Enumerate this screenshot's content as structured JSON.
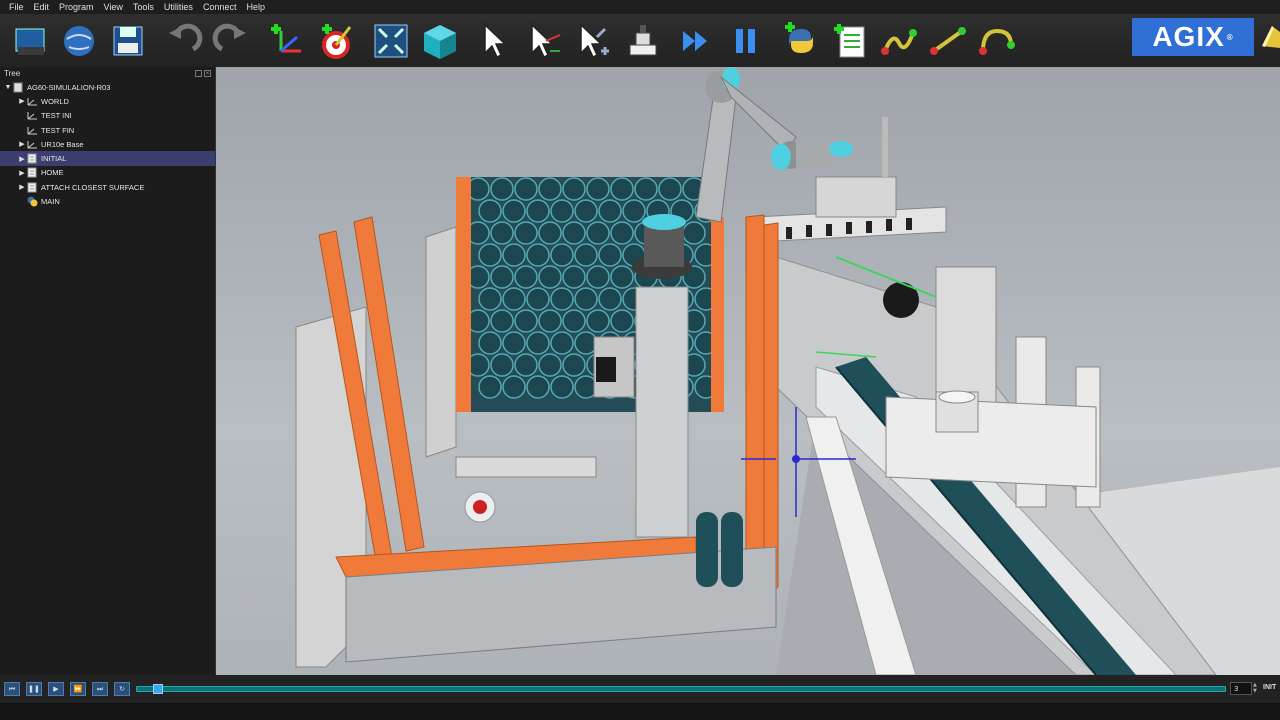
{
  "menu": [
    "File",
    "Edit",
    "Program",
    "View",
    "Tools",
    "Utilities",
    "Connect",
    "Help"
  ],
  "toolbar": {
    "buttons": [
      "open-station-icon",
      "online-library-icon",
      "save-icon",
      "undo-icon",
      "redo-icon",
      "add-reference-frame-icon",
      "add-target-icon",
      "fit-all-icon",
      "view-iso-icon",
      "select-icon",
      "move-reference-icon",
      "move-object-icon",
      "add-tool-icon",
      "fast-simulation-icon",
      "pause-simulation-icon",
      "python-script-icon",
      "add-program-icon",
      "move-joint-icon",
      "move-linear-icon",
      "move-circular-icon"
    ],
    "logo_text": "AGIX",
    "logo_mark": "®"
  },
  "tree": {
    "title": "Tree",
    "items": [
      {
        "label": "AG60-SIMULALION-R03",
        "level": 0,
        "icon": "station-icon",
        "expanded": true,
        "selected": false
      },
      {
        "label": "WORLD",
        "level": 1,
        "icon": "frame-icon",
        "expanded": false,
        "selected": false
      },
      {
        "label": "TEST INI",
        "level": 1,
        "icon": "frame-icon",
        "expanded": null,
        "selected": false
      },
      {
        "label": "TEST FIN",
        "level": 1,
        "icon": "frame-icon",
        "expanded": null,
        "selected": false
      },
      {
        "label": "UR10e Base",
        "level": 1,
        "icon": "frame-icon",
        "expanded": false,
        "selected": false
      },
      {
        "label": "INITIAL",
        "level": 1,
        "icon": "program-icon",
        "expanded": false,
        "selected": true
      },
      {
        "label": "HOME",
        "level": 1,
        "icon": "program-icon",
        "expanded": false,
        "selected": false
      },
      {
        "label": "ATTACH CLOSEST SURFACE",
        "level": 1,
        "icon": "program-icon",
        "expanded": false,
        "selected": false
      },
      {
        "label": "MAIN",
        "level": 1,
        "icon": "python-icon",
        "expanded": null,
        "selected": false
      }
    ]
  },
  "playback": {
    "buttons": [
      "skip-start-icon",
      "pause-icon",
      "play-icon",
      "fast-forward-icon",
      "skip-end-icon",
      "loop-icon"
    ],
    "progress": 0.015,
    "step_value": "3",
    "program_label": "INIT"
  },
  "colors": {
    "accent": "#2f6fd6",
    "frame_orange": "#f07a3a",
    "pipe_teal": "#2c5a66",
    "robot_cyan": "#4fd0e0",
    "selection": "#3a3f6e"
  }
}
